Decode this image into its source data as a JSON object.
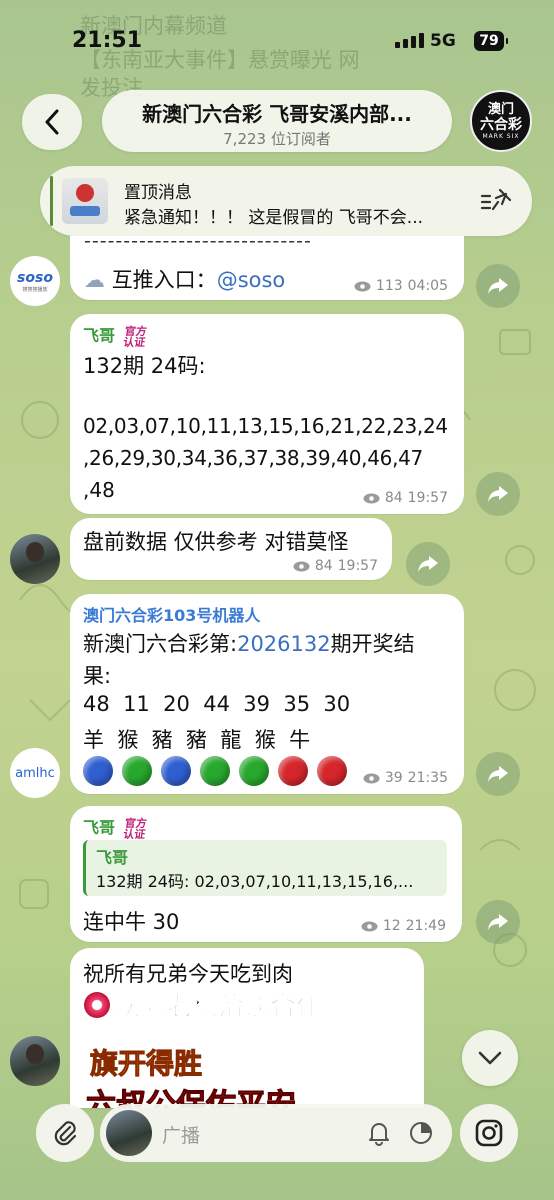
{
  "status": {
    "time": "21:51",
    "network": "5G",
    "battery": "79"
  },
  "background_text": [
    "新澳门内幕频道",
    "【东南亚大事件】悬赏曝光 网",
    "发投注"
  ],
  "header": {
    "title": "新澳门六合彩 飞哥安溪内部...",
    "subscribers": "7,223 位订阅者",
    "avatar_line1": "澳门",
    "avatar_line2": "六合彩",
    "avatar_line3": "MARK SIX"
  },
  "pinned": {
    "title": "置顶消息",
    "text": "紧急通知！！！ 这是假冒的 飞哥不会..."
  },
  "messages": [
    {
      "dashes": "-----------------------------",
      "text_prefix": "互推入口：",
      "link": "@soso",
      "views": "113",
      "time": "04:05",
      "avatar": "soso",
      "avatar_sub": "搜搜搜播放"
    },
    {
      "sender": "飞哥",
      "badge": "官方认证",
      "line1": "132期 24码:",
      "numbers1": "02,03,07,10,11,13,15,16,21,22,23,24",
      "numbers2": ",26,29,30,34,36,37,38,39,40,46,47",
      "numbers3": ",48",
      "views": "84",
      "time": "19:57"
    },
    {
      "text": "盘前数据 仅供参考 对错莫怪",
      "views": "84",
      "time": "19:57"
    },
    {
      "sender": "澳门六合彩103号机器人",
      "line1_prefix": "新澳门六合彩第:",
      "line1_link": "2026132",
      "line1_suffix": "期开奖结",
      "line2": "果:",
      "numbers": "48  11  20  44  39  35  30",
      "zodiac": "羊  猴  豬  豬  龍  猴  牛",
      "balls": [
        "#2f5fd0",
        "#27a82e",
        "#2f5fd0",
        "#27a82e",
        "#27a82e",
        "#d6262b",
        "#d6262b"
      ],
      "views": "39",
      "time": "21:35",
      "avatar": "amlhc"
    },
    {
      "sender": "飞哥",
      "badge": "官方认证",
      "quote_sender": "飞哥",
      "quote_text": "132期 24码: 02,03,07,10,11,13,15,16,...",
      "text": "连中牛 30",
      "views": "12",
      "time": "21:49"
    },
    {
      "line1": "祝所有兄弟今天吃到肉",
      "banner1": "欢迎老板洽谈合作",
      "banner2": "旗开得胜",
      "banner3": "六叔公保佑平安"
    }
  ],
  "input": {
    "placeholder": "广播"
  },
  "colors": {
    "accent": "#3a7bd5",
    "green_name": "#3a9a3a",
    "robot_name": "#3a7bd5"
  }
}
